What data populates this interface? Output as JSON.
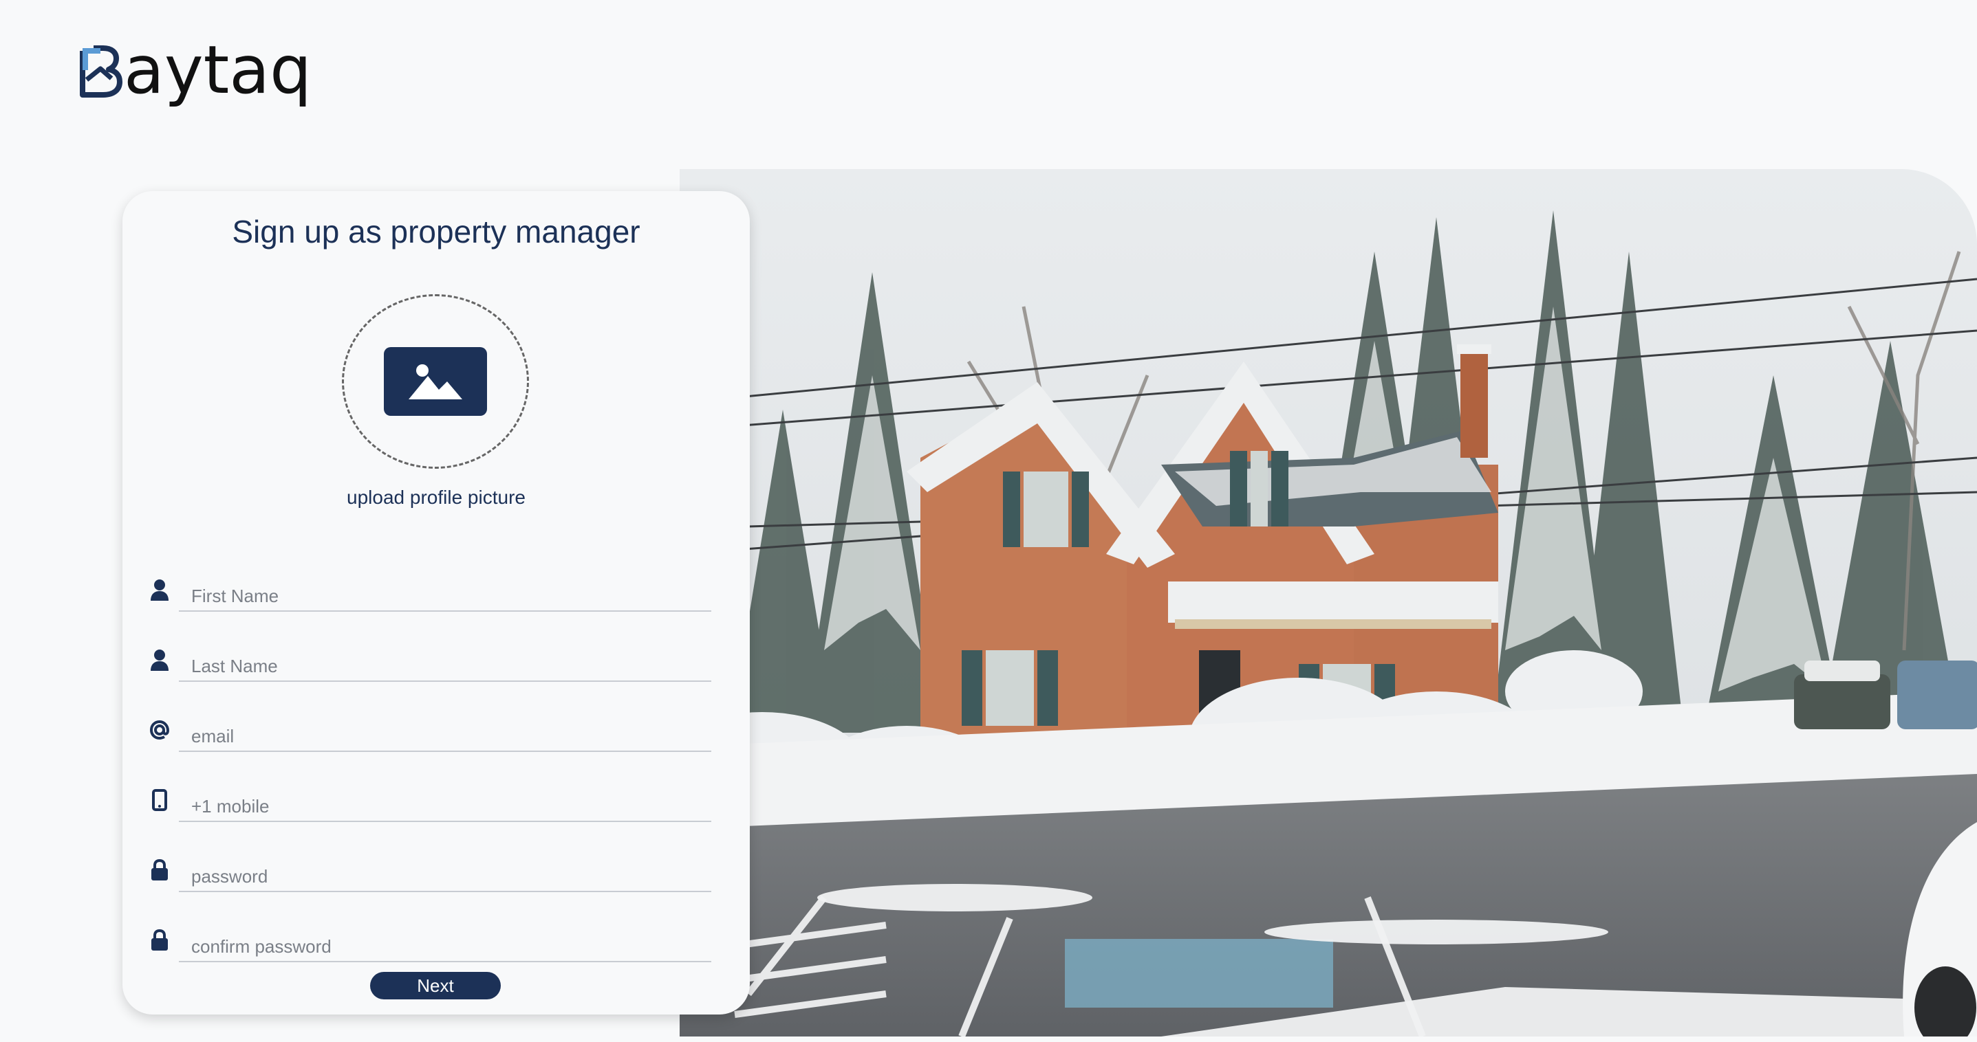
{
  "brand": {
    "name": "aytaq",
    "colors": {
      "primary": "#1c3157",
      "accent_light": "#5b9bd5",
      "background": "#f8f9fa"
    }
  },
  "signup": {
    "title": "Sign up as property manager",
    "upload_label": "upload profile picture",
    "upload_icon": "image-icon",
    "fields": {
      "first_name": {
        "placeholder": "First Name",
        "icon": "person-icon",
        "value": ""
      },
      "last_name": {
        "placeholder": "Last Name",
        "icon": "person-icon",
        "value": ""
      },
      "email": {
        "placeholder": "email",
        "icon": "at-icon",
        "value": ""
      },
      "mobile": {
        "placeholder": "+1 mobile",
        "icon": "phone-icon",
        "value": ""
      },
      "password": {
        "placeholder": "password",
        "icon": "lock-icon",
        "value": ""
      },
      "confirm_password": {
        "placeholder": "confirm password",
        "icon": "lock-icon",
        "value": ""
      }
    },
    "next_label": "Next"
  },
  "hero": {
    "image": "snowy-brick-house-photo"
  }
}
